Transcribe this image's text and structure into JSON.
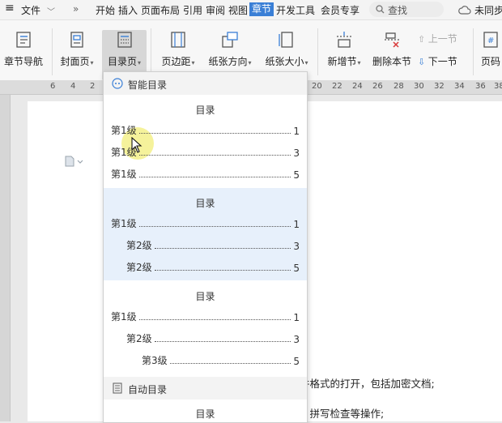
{
  "menubar": {
    "hamburger": "≡",
    "file": "文件",
    "more": "»",
    "items": [
      "开始",
      "插入",
      "页面布局",
      "引用",
      "审阅",
      "视图",
      "章节",
      "开发工具",
      "会员专享"
    ],
    "active_index": 6,
    "search_label": "查找",
    "sync_label": "未同步"
  },
  "ribbon": {
    "buttons": [
      {
        "label": "章节导航",
        "icon": "chapter-nav-icon"
      },
      {
        "label": "封面页",
        "icon": "cover-page-icon",
        "has_caret": true
      },
      {
        "label": "目录页",
        "icon": "toc-page-icon",
        "has_caret": true,
        "pressed": true
      },
      {
        "label": "页边距",
        "icon": "margins-icon",
        "has_caret": true
      },
      {
        "label": "纸张方向",
        "icon": "orientation-icon",
        "has_caret": true
      },
      {
        "label": "纸张大小",
        "icon": "paper-size-icon",
        "has_caret": true
      },
      {
        "label": "新增节",
        "icon": "add-section-icon",
        "has_caret": true
      },
      {
        "label": "删除本节",
        "icon": "delete-section-icon"
      },
      {
        "label": "页码",
        "icon": "page-number-icon"
      }
    ],
    "prev_section": "上一节",
    "next_section": "下一节"
  },
  "ruler": {
    "left_ticks": [
      "6",
      "4",
      "2"
    ],
    "right_ticks": [
      "20",
      "22",
      "24",
      "26",
      "28",
      "30",
      "32",
      "34",
      "36",
      "38"
    ]
  },
  "dropdown": {
    "smart_header": "智能目录",
    "auto_header": "自动目录",
    "templates": [
      {
        "title": "目录",
        "entries": [
          {
            "label": "第1级",
            "page": "1"
          },
          {
            "label": "第1级",
            "page": "3"
          },
          {
            "label": "第1级",
            "page": "5"
          }
        ]
      },
      {
        "title": "目录",
        "entries": [
          {
            "label": "第1级",
            "page": "1"
          },
          {
            "label": "第2级",
            "page": "3"
          },
          {
            "label": "第2级",
            "page": "5"
          }
        ]
      },
      {
        "title": "目录",
        "entries": [
          {
            "label": "第1级",
            "page": "1"
          },
          {
            "label": "第2级",
            "page": "3"
          },
          {
            "label": "第3级",
            "page": "5"
          }
        ]
      }
    ],
    "auto_title": "目录"
  },
  "document": {
    "line1": "件格式的打开，包括加密文档;",
    "line2": "、拼写检查等操作;"
  },
  "colors": {
    "accent": "#3a7fd6",
    "highlight_row": "#e7f0fb",
    "cursor_halo": "#f3f08a"
  }
}
